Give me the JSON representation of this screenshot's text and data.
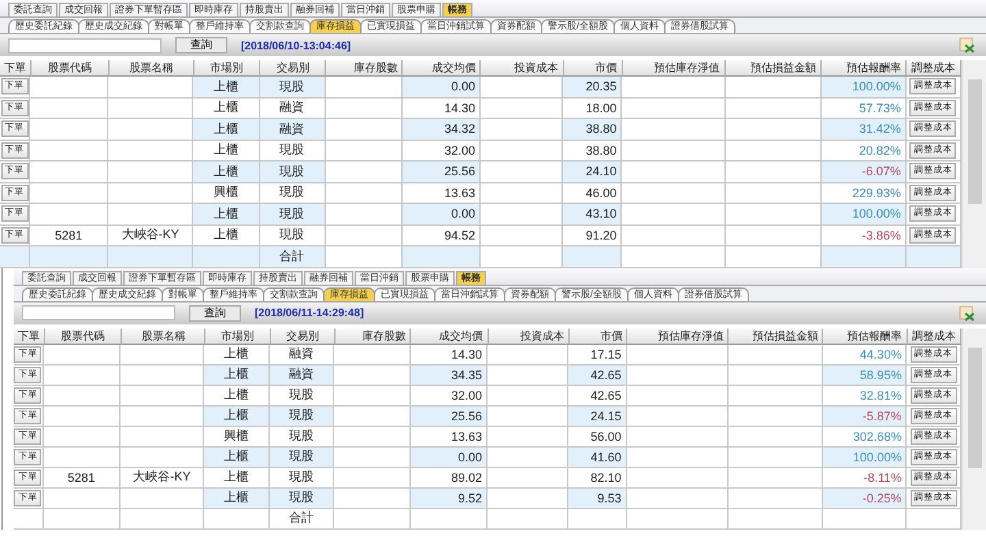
{
  "panels": [
    {
      "main_tabs": [
        {
          "label": "委託查詢",
          "selected": false
        },
        {
          "label": "成交回報",
          "selected": false
        },
        {
          "label": "證券下單暫存區",
          "selected": false
        },
        {
          "label": "即時庫存",
          "selected": false
        },
        {
          "label": "持股賣出",
          "selected": false
        },
        {
          "label": "融券回補",
          "selected": false
        },
        {
          "label": "當日沖銷",
          "selected": false
        },
        {
          "label": "股票申購",
          "selected": false
        },
        {
          "label": "帳務",
          "selected": true
        }
      ],
      "sub_tabs": [
        {
          "label": "歷史委託紀錄",
          "selected": false
        },
        {
          "label": "歷史成交紀錄",
          "selected": false
        },
        {
          "label": "對帳單",
          "selected": false
        },
        {
          "label": "整戶維持率",
          "selected": false
        },
        {
          "label": "交割款查詢",
          "selected": false
        },
        {
          "label": "庫存損益",
          "selected": true
        },
        {
          "label": "已實現損益",
          "selected": false
        },
        {
          "label": "當日沖銷試算",
          "selected": false
        },
        {
          "label": "資券配額",
          "selected": false
        },
        {
          "label": "警示股/全額股",
          "selected": false
        },
        {
          "label": "個人資料",
          "selected": false
        },
        {
          "label": "證券借股試算",
          "selected": false
        }
      ],
      "query": {
        "button": "查詢",
        "timestamp": "[2018/06/10-13:04:46]"
      },
      "columns": [
        "下單",
        "股票代碼",
        "股票名稱",
        "市場別",
        "交易別",
        "庫存股數",
        "成交均價",
        "投資成本",
        "市價",
        "預估庫存淨值",
        "預估損益金額",
        "預估報酬率",
        "調整成本"
      ],
      "rows": [
        {
          "order": "下單",
          "market": "上櫃",
          "trade": "現股",
          "avg": "0.00",
          "price": "20.35",
          "ret": "100.00%",
          "color": "#3a8fc2",
          "shaded": true,
          "adjust": "調整成本"
        },
        {
          "order": "下單",
          "market": "上櫃",
          "trade": "融資",
          "avg": "14.30",
          "price": "18.00",
          "ret": "57.73%",
          "color": "#3a8fc2",
          "shaded": false,
          "adjust": "調整成本"
        },
        {
          "order": "下單",
          "market": "上櫃",
          "trade": "融資",
          "avg": "34.32",
          "price": "38.80",
          "ret": "31.42%",
          "color": "#3a8fc2",
          "shaded": true,
          "adjust": "調整成本"
        },
        {
          "order": "下單",
          "market": "上櫃",
          "trade": "現股",
          "avg": "32.00",
          "price": "38.80",
          "ret": "20.82%",
          "color": "#3a8fc2",
          "shaded": false,
          "adjust": "調整成本"
        },
        {
          "order": "下單",
          "market": "上櫃",
          "trade": "現股",
          "avg": "25.56",
          "price": "24.10",
          "ret": "-6.07%",
          "color": "#b8485a",
          "shaded": true,
          "adjust": "調整成本"
        },
        {
          "order": "下單",
          "market": "興櫃",
          "trade": "現股",
          "avg": "13.63",
          "price": "46.00",
          "ret": "229.93%",
          "color": "#3a8fc2",
          "shaded": false,
          "adjust": "調整成本"
        },
        {
          "order": "下單",
          "market": "上櫃",
          "trade": "現股",
          "avg": "0.00",
          "price": "43.10",
          "ret": "100.00%",
          "color": "#3a8fc2",
          "shaded": true,
          "adjust": "調整成本"
        },
        {
          "order": "下單",
          "code": "5281",
          "name": "大峽谷-KY",
          "market": "上櫃",
          "trade": "現股",
          "avg": "94.52",
          "price": "91.20",
          "ret": "-3.86%",
          "color": "#b8485a",
          "shaded": false,
          "adjust": "調整成本"
        }
      ],
      "total": {
        "label": "合計",
        "shaded": true
      }
    },
    {
      "main_tabs": [
        {
          "label": "委託查詢",
          "selected": false
        },
        {
          "label": "成交回報",
          "selected": false
        },
        {
          "label": "證券下單暫存區",
          "selected": false
        },
        {
          "label": "即時庫存",
          "selected": false
        },
        {
          "label": "持股賣出",
          "selected": false
        },
        {
          "label": "融券回補",
          "selected": false
        },
        {
          "label": "當日沖銷",
          "selected": false
        },
        {
          "label": "股票申購",
          "selected": false
        },
        {
          "label": "帳務",
          "selected": true
        }
      ],
      "sub_tabs": [
        {
          "label": "歷史委託紀錄",
          "selected": false
        },
        {
          "label": "歷史成交紀錄",
          "selected": false
        },
        {
          "label": "對帳單",
          "selected": false
        },
        {
          "label": "整戶維持率",
          "selected": false
        },
        {
          "label": "交割款查詢",
          "selected": false
        },
        {
          "label": "庫存損益",
          "selected": true
        },
        {
          "label": "已實現損益",
          "selected": false
        },
        {
          "label": "當日沖銷試算",
          "selected": false
        },
        {
          "label": "資券配額",
          "selected": false
        },
        {
          "label": "警示股/全額股",
          "selected": false
        },
        {
          "label": "個人資料",
          "selected": false
        },
        {
          "label": "證券借股試算",
          "selected": false
        }
      ],
      "query": {
        "button": "查詢",
        "timestamp": "[2018/06/11-14:29:48]"
      },
      "columns": [
        "下單",
        "股票代碼",
        "股票名稱",
        "市場別",
        "交易別",
        "庫存股數",
        "成交均價",
        "投資成本",
        "市價",
        "預估庫存淨值",
        "預估損益金額",
        "預估報酬率",
        "調整成本"
      ],
      "rows": [
        {
          "order": "下單",
          "market": "上櫃",
          "trade": "融資",
          "avg": "14.30",
          "price": "17.15",
          "ret": "44.30%",
          "color": "#3a8fc2",
          "shaded": false,
          "adjust": "調整成本"
        },
        {
          "order": "下單",
          "market": "上櫃",
          "trade": "融資",
          "avg": "34.35",
          "price": "42.65",
          "ret": "58.95%",
          "color": "#3a8fc2",
          "shaded": true,
          "adjust": "調整成本"
        },
        {
          "order": "下單",
          "market": "上櫃",
          "trade": "現股",
          "avg": "32.00",
          "price": "42.65",
          "ret": "32.81%",
          "color": "#3a8fc2",
          "shaded": false,
          "adjust": "調整成本"
        },
        {
          "order": "下單",
          "market": "上櫃",
          "trade": "現股",
          "avg": "25.56",
          "price": "24.15",
          "ret": "-5.87%",
          "color": "#b8485a",
          "shaded": true,
          "adjust": "調整成本"
        },
        {
          "order": "下單",
          "market": "興櫃",
          "trade": "現股",
          "avg": "13.63",
          "price": "56.00",
          "ret": "302.68%",
          "color": "#3a8fc2",
          "shaded": false,
          "adjust": "調整成本"
        },
        {
          "order": "下單",
          "market": "上櫃",
          "trade": "現股",
          "avg": "0.00",
          "price": "41.60",
          "ret": "100.00%",
          "color": "#3a8fc2",
          "shaded": true,
          "adjust": "調整成本"
        },
        {
          "order": "下單",
          "code": "5281",
          "name": "大峽谷-KY",
          "market": "上櫃",
          "trade": "現股",
          "avg": "89.02",
          "price": "82.10",
          "ret": "-8.11%",
          "color": "#b8485a",
          "shaded": false,
          "adjust": "調整成本"
        },
        {
          "order": "下單",
          "market": "上櫃",
          "trade": "現股",
          "avg": "9.52",
          "price": "9.53",
          "ret": "-0.25%",
          "color": "#b8485a",
          "shaded": true,
          "adjust": "調整成本"
        }
      ],
      "total": {
        "label": "合計",
        "shaded": false
      }
    }
  ]
}
